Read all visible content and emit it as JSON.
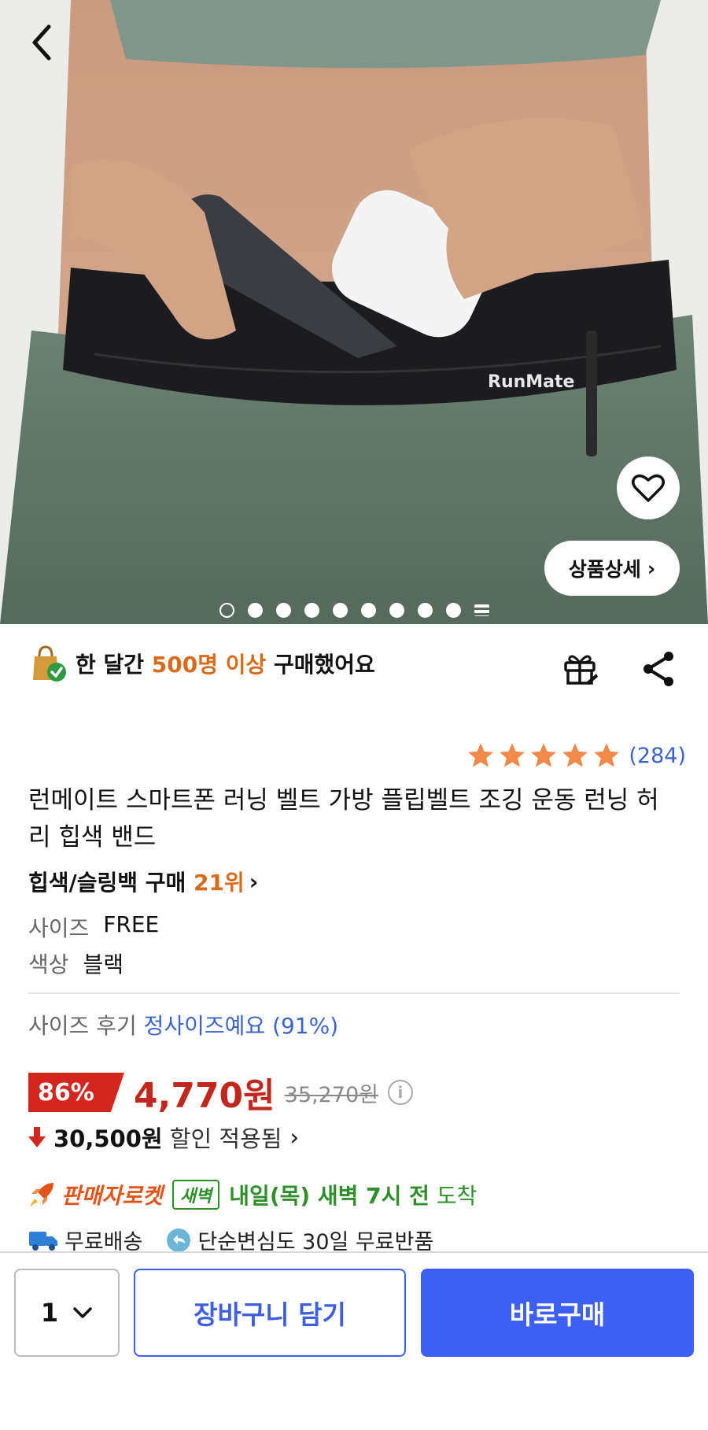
{
  "product": {
    "image_logo_text": "RunMate",
    "detail_button_label": "상품상세",
    "detail_chevron": "›",
    "image_count": 10,
    "active_image_index": 0
  },
  "purchase_stat": {
    "prefix": "한 달간 ",
    "highlight": "500명 이상",
    "suffix": " 구매했어요"
  },
  "rating": {
    "stars": 5,
    "review_count": "(284)"
  },
  "title": "런메이트 스마트폰 러닝 벨트 가방 플립벨트 조깅 운동 런닝 허리 힙색 밴드",
  "rank": {
    "category": "힙색/슬링백 구매 ",
    "position": "21위",
    "chevron": "›"
  },
  "options": [
    {
      "key": "사이즈",
      "value": "FREE"
    },
    {
      "key": "색상",
      "value": "블랙"
    }
  ],
  "size_review": {
    "label": "사이즈 후기 ",
    "value": "정사이즈예요 (91%)"
  },
  "price": {
    "discount_rate": "86%",
    "sale_price": "4,770원",
    "original_price": "35,270원",
    "info_icon": "i"
  },
  "discount": {
    "arrow": "↓",
    "amount": "30,500원",
    "text": " 할인 적용됨",
    "chevron": "›"
  },
  "delivery": {
    "seller_label": "판매자로켓",
    "dawn_badge": "새벽",
    "eta": "내일(목) 새벽 7시 전",
    "eta_tail": " 도착"
  },
  "shipping": {
    "free_shipping": "무료배송",
    "free_return": "단순변심도 30일 무료반품"
  },
  "bottom_bar": {
    "quantity": "1",
    "cart_label": "장바구니 담기",
    "buy_label": "바로구매"
  },
  "colors": {
    "accent_blue": "#3d5ff2",
    "highlight_orange": "#d86b1b",
    "price_red": "#c2271e",
    "star_orange": "#f0894a",
    "delivery_green": "#2e8f2b"
  }
}
